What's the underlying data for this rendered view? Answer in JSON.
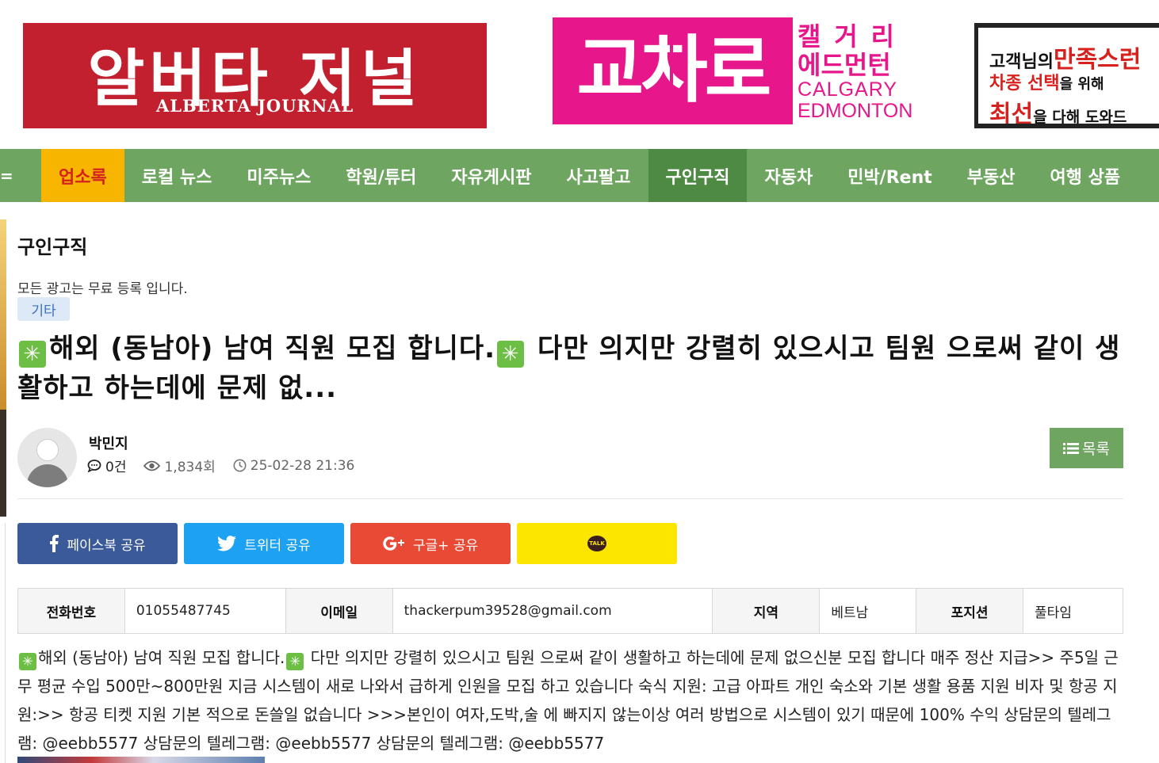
{
  "header": {
    "logo_korean": "알버타 저널",
    "logo_english": "ALBERTA JOURNAL",
    "gcr_logo": "교차로",
    "gcr_city_kr_1": "캘 거 리",
    "gcr_city_kr_2": "에드먼턴",
    "gcr_city_en_1": "CALGARY",
    "gcr_city_en_2": "EDMONTON",
    "ad_line1_a": "고객님의",
    "ad_line1_b": "만족스런",
    "ad_line2_a": "차종 선택",
    "ad_line2_b": "을 위해",
    "ad_line3_a": "최선",
    "ad_line3_b": "을 다해 도와드",
    "colors": {
      "brand_red": "#c2202f",
      "gcr_pink": "#e7168a"
    }
  },
  "nav": {
    "edge": "=",
    "items": [
      {
        "label": "업소록"
      },
      {
        "label": "로컬 뉴스"
      },
      {
        "label": "미주뉴스"
      },
      {
        "label": "학원/튜터"
      },
      {
        "label": "자유게시판"
      },
      {
        "label": "사고팔고"
      },
      {
        "label": "구인구직"
      },
      {
        "label": "자동차"
      },
      {
        "label": "민박/Rent"
      },
      {
        "label": "부동산"
      },
      {
        "label": "여행 상품"
      }
    ],
    "colors": {
      "bar": "#6ea561",
      "highlight": "#f7b500",
      "current": "#4e8a43"
    }
  },
  "board": {
    "title": "구인구직",
    "description": "모든 광고는 무료 등록 입니다.",
    "category": "기타"
  },
  "post": {
    "title_icon": "sparkle-icon",
    "title_part1": "해외 (동남아) 남여 직원 모집 합니다.",
    "title_part2": " 다만 의지만 강렬히 있으시고 팀원 으로써 같이 생활하고 하는데에 문제 없...",
    "author": "박민지",
    "comments": "0건",
    "views": "1,834회",
    "date": "25-02-28 21:36",
    "list_button": "목록"
  },
  "share": {
    "facebook": "페이스북 공유",
    "twitter": "트위터 공유",
    "google": "구글+ 공유",
    "kakao_icon_text": "TALK"
  },
  "info": {
    "phone_label": "전화번호",
    "phone_value": "01055487745",
    "email_label": "이메일",
    "email_value": "thackerpum39528@gmail.com",
    "region_label": "지역",
    "region_value": "베트남",
    "position_label": "포지션",
    "position_value": "풀타임"
  },
  "body": {
    "part1": "해외 (동남아) 남여 직원 모집 합니다.",
    "part2": " 다만 의지만 강렬히 있으시고 팀원 으로써 같이 생활하고 하는데에 문제 없으신분 모집 합니다 매주 정산 지급>> 주5일 근무 평균 수입 500만~800만원 지금 시스템이 새로 나와서 급하게 인원을 모집 하고 있습니다 숙식 지원: 고급 아파트 개인 숙소와 기본 생활 용품 지원 비자 및 항공 지원:>> 항공 티켓 지원 기본 적으로 돈쓸일 없습니다 >>>본인이 여자,도박,술 에 빠지지 않는이상 여러 방법으로 시스템이 있기 때문에 100% 수익 상담문의 텔레그램: @eebb5577 상담문의 텔레그램: @eebb5577 상담문의 텔레그램: @eebb5577"
  }
}
